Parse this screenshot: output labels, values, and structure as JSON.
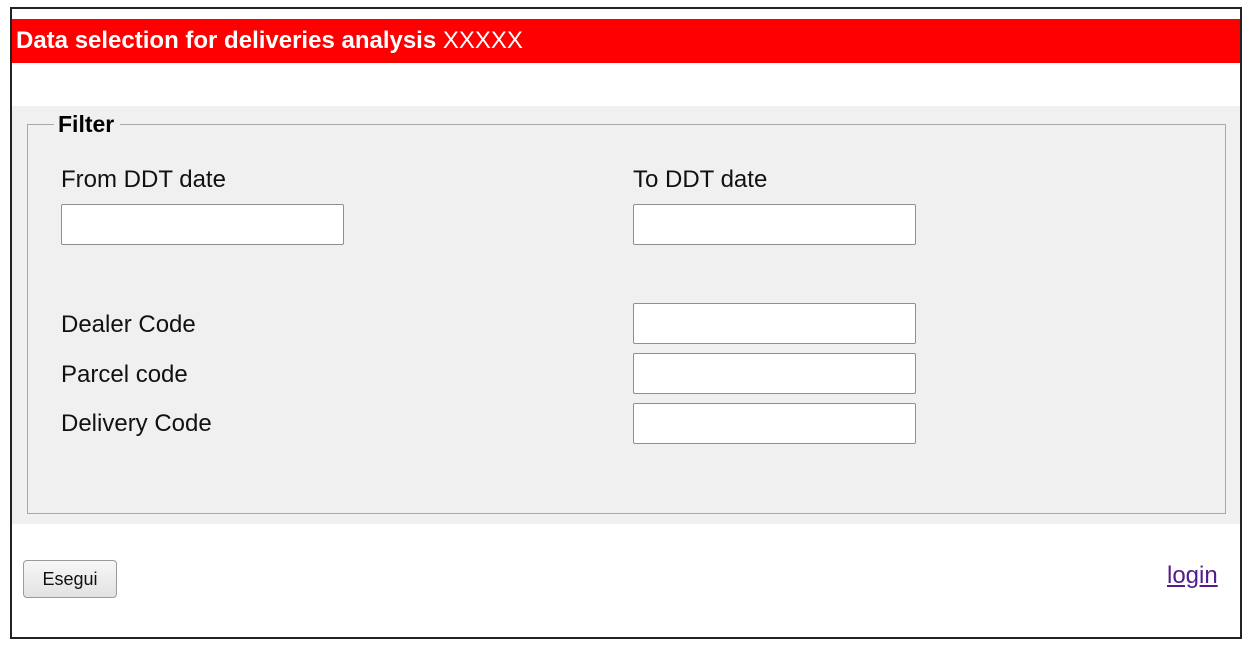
{
  "header": {
    "title_bold": "Data selection for deliveries analysis",
    "title_suffix": "XXXXX",
    "color": "#ff0000"
  },
  "filter": {
    "legend": "Filter",
    "from_date": {
      "label": "From DDT date",
      "value": ""
    },
    "to_date": {
      "label": "To DDT date",
      "value": ""
    },
    "dealer_code": {
      "label": "Dealer Code",
      "value": ""
    },
    "parcel_code": {
      "label": "Parcel code",
      "value": ""
    },
    "delivery_code": {
      "label": "Delivery Code",
      "value": ""
    }
  },
  "actions": {
    "execute_label": "Esegui",
    "login_label": "login"
  }
}
